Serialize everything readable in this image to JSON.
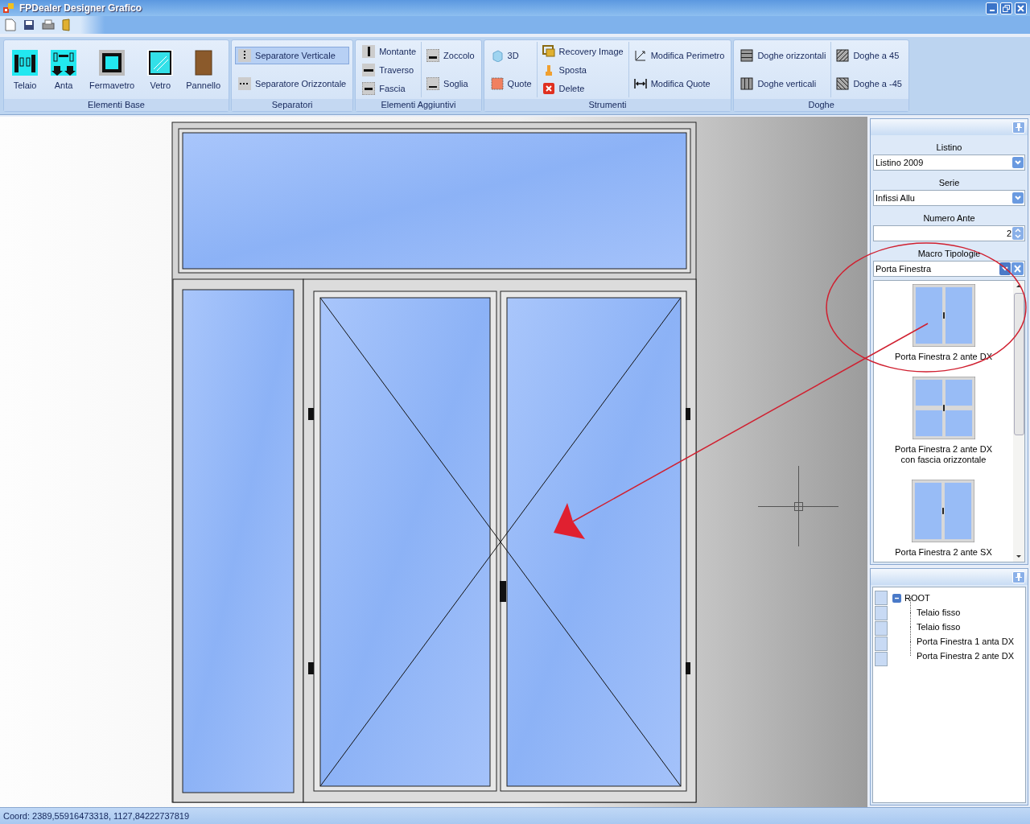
{
  "window": {
    "title": "FPDealer Designer Grafico"
  },
  "ribbon": {
    "groups": [
      {
        "label": "Elementi Base",
        "columns": [
          [
            {
              "label": "Telaio",
              "kind": "large",
              "selected": false
            }
          ],
          [
            {
              "label": "Anta",
              "kind": "large",
              "selected": false
            }
          ],
          [
            {
              "label": "Fermavetro",
              "kind": "large",
              "selected": false
            }
          ],
          [
            {
              "label": "Vetro",
              "kind": "large",
              "selected": false
            }
          ],
          [
            {
              "label": "Pannello",
              "kind": "large",
              "selected": false
            }
          ]
        ]
      },
      {
        "label": "Separatori",
        "columns": [
          [
            {
              "label": "Separatore Verticale",
              "kind": "small",
              "selected": true
            },
            {
              "label": "Separatore Orizzontale",
              "kind": "small",
              "selected": false
            }
          ]
        ]
      },
      {
        "label": "Elementi Aggiuntivi",
        "columns": [
          [
            {
              "label": "Montante",
              "kind": "small",
              "selected": false
            },
            {
              "label": "Traverso",
              "kind": "small",
              "selected": false
            },
            {
              "label": "Fascia",
              "kind": "small",
              "selected": false
            }
          ],
          [
            {
              "label": "Zoccolo",
              "kind": "small",
              "selected": false
            },
            {
              "label": "Soglia",
              "kind": "small",
              "selected": false
            }
          ]
        ]
      },
      {
        "label": "Strumenti",
        "columns": [
          [
            {
              "label": "3D",
              "kind": "small",
              "selected": false
            },
            {
              "label": "Quote",
              "kind": "small",
              "selected": false
            }
          ],
          [
            {
              "label": "Recovery Image",
              "kind": "small",
              "selected": false
            },
            {
              "label": "Sposta",
              "kind": "small",
              "selected": false
            },
            {
              "label": "Delete",
              "kind": "small",
              "selected": false
            }
          ],
          [
            {
              "label": "Modifica Perimetro",
              "kind": "small",
              "selected": false
            },
            {
              "label": "Modifica Quote",
              "kind": "small",
              "selected": false
            }
          ]
        ]
      },
      {
        "label": "Doghe",
        "columns": [
          [
            {
              "label": "Doghe orizzontali",
              "kind": "small",
              "selected": false
            },
            {
              "label": "Doghe verticali",
              "kind": "small",
              "selected": false
            }
          ],
          [
            {
              "label": "Doghe a 45",
              "kind": "small",
              "selected": false
            },
            {
              "label": "Doghe a -45",
              "kind": "small",
              "selected": false
            }
          ]
        ]
      }
    ]
  },
  "properties": {
    "fields": [
      {
        "label": "Listino",
        "kind": "combo",
        "value": "Listino 2009"
      },
      {
        "label": "Serie",
        "kind": "combo",
        "value": "Infissi Allu"
      },
      {
        "label": "Numero Ante",
        "kind": "spinner",
        "value": "2"
      },
      {
        "label": "Macro Tipologie",
        "kind": "clearable",
        "value": "Porta Finestra"
      }
    ],
    "gallery": [
      {
        "caption": "Porta Finestra 2 ante DX",
        "kind": "plain"
      },
      {
        "caption": "Porta Finestra 2 ante DX\ncon fascia orizzontale",
        "kind": "crossbar"
      },
      {
        "caption": "Porta Finestra 2 ante SX",
        "kind": "plain"
      }
    ]
  },
  "tree": {
    "label": "ROOT",
    "expanded": true,
    "children": [
      {
        "label": "Telaio fisso"
      },
      {
        "label": "Telaio fisso"
      },
      {
        "label": "Porta Finestra 1 anta DX"
      },
      {
        "label": "Porta Finestra 2 ante DX"
      }
    ]
  },
  "status_bar": {
    "text": "Coord: 2389,55916473318, 1127,84222737819"
  }
}
